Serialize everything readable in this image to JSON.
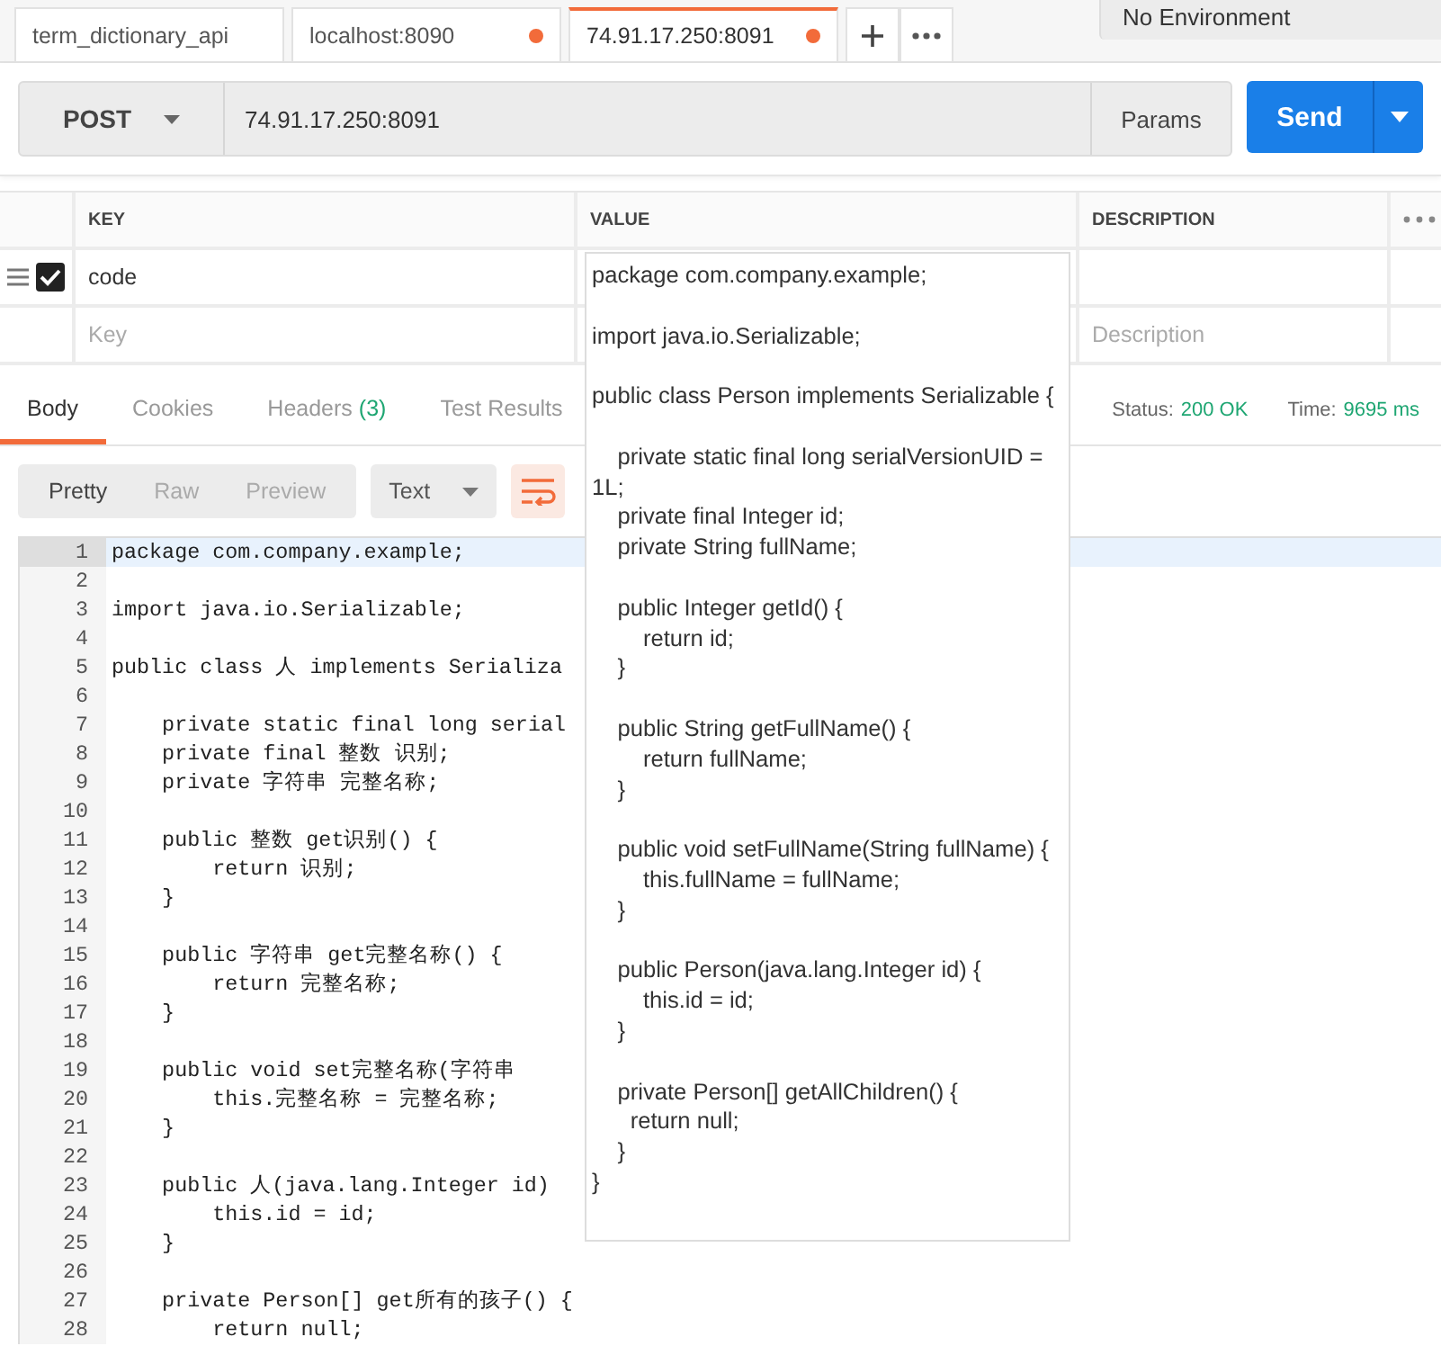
{
  "tabs": [
    {
      "label": "term_dictionary_api",
      "unsaved": false,
      "selected": false
    },
    {
      "label": "localhost:8090",
      "unsaved": true,
      "selected": false
    },
    {
      "label": "74.91.17.250:8091",
      "unsaved": true,
      "selected": true
    }
  ],
  "environment": {
    "value": "No Environment"
  },
  "request": {
    "method": "POST",
    "url": "74.91.17.250:8091",
    "params_button": "Params",
    "send_button": "Send"
  },
  "params_table": {
    "columns": [
      "KEY",
      "VALUE",
      "DESCRIPTION"
    ],
    "rows": [
      {
        "checked": true,
        "key": "code"
      }
    ],
    "new_row": {
      "key_placeholder": "Key",
      "description_placeholder": "Description"
    }
  },
  "value_popup": {
    "blocks": [
      [
        "package com.company.example;"
      ],
      [
        "import java.io.Serializable;"
      ],
      [
        "public class Person implements Serializable {"
      ],
      [
        "    private static final long serialVersionUID = 1L;",
        "    private final Integer id;",
        "    private String fullName;"
      ],
      [
        "    public Integer getId() {",
        "        return id;",
        "    }"
      ],
      [
        "    public String getFullName() {",
        "        return fullName;",
        "    }"
      ],
      [
        "    public void setFullName(String fullName) {",
        "        this.fullName = fullName;",
        "    }"
      ],
      [
        "    public Person(java.lang.Integer id) {",
        "        this.id = id;",
        "    }"
      ],
      [
        "    private Person[] getAllChildren() {",
        "      return null;",
        "    }",
        "}"
      ]
    ]
  },
  "response_tabs": [
    {
      "label": "Body",
      "selected": true
    },
    {
      "label": "Cookies",
      "selected": false
    },
    {
      "label": "Headers",
      "count": "(3)",
      "selected": false
    },
    {
      "label": "Test Results",
      "selected": false
    }
  ],
  "status": {
    "label": "Status:",
    "value": "200 OK"
  },
  "time": {
    "label": "Time:",
    "value": "9695 ms"
  },
  "view_modes": [
    {
      "label": "Pretty",
      "selected": true
    },
    {
      "label": "Raw",
      "selected": false
    },
    {
      "label": "Preview",
      "selected": false
    }
  ],
  "format": {
    "value": "Text"
  },
  "wrap_lines": true,
  "code": [
    {
      "number": "1",
      "text": "package com.company.example;",
      "selected": true
    },
    {
      "number": "2",
      "selected": false
    },
    {
      "number": "3",
      "text": "import java.io.Serializable;",
      "selected": false
    },
    {
      "number": "4",
      "selected": false
    },
    {
      "number": "5",
      "text": "public class 人 implements Serializa",
      "selected": false
    },
    {
      "number": "6",
      "selected": false
    },
    {
      "number": "7",
      "text": "    private static final long serial",
      "selected": false
    },
    {
      "number": "8",
      "text": "    private final 整数 识别;",
      "selected": false
    },
    {
      "number": "9",
      "text": "    private 字符串 完整名称;",
      "selected": false
    },
    {
      "number": "10",
      "selected": false
    },
    {
      "number": "11",
      "text": "    public 整数 get识别() {",
      "selected": false
    },
    {
      "number": "12",
      "text": "        return 识别;",
      "selected": false
    },
    {
      "number": "13",
      "text": "    }",
      "selected": false
    },
    {
      "number": "14",
      "selected": false
    },
    {
      "number": "15",
      "text": "    public 字符串 get完整名称() {",
      "selected": false
    },
    {
      "number": "16",
      "text": "        return 完整名称;",
      "selected": false
    },
    {
      "number": "17",
      "text": "    }",
      "selected": false
    },
    {
      "number": "18",
      "selected": false
    },
    {
      "number": "19",
      "text": "    public void set完整名称(字符串",
      "selected": false
    },
    {
      "number": "20",
      "text": "        this.完整名称 = 完整名称;",
      "selected": false
    },
    {
      "number": "21",
      "text": "    }",
      "selected": false
    },
    {
      "number": "22",
      "selected": false
    },
    {
      "number": "23",
      "text": "    public 人(java.lang.Integer id)",
      "selected": false
    },
    {
      "number": "24",
      "text": "        this.id = id;",
      "selected": false
    },
    {
      "number": "25",
      "text": "    }",
      "selected": false
    },
    {
      "number": "26",
      "selected": false
    },
    {
      "number": "27",
      "text": "    private Person[] get所有的孩子() {",
      "selected": false
    },
    {
      "number": "28",
      "text": "        return null;",
      "selected": false
    }
  ]
}
